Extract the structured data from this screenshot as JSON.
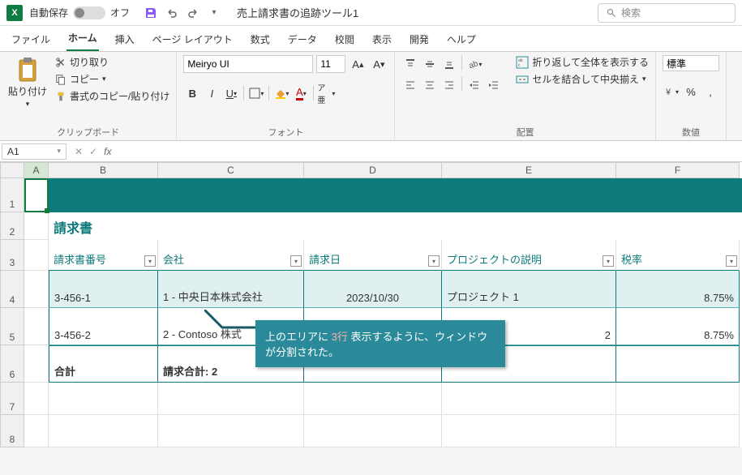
{
  "title_bar": {
    "excel_icon_text": "X",
    "autosave_label": "自動保存",
    "autosave_state": "オフ",
    "doc_title": "売上請求書の追跡ツール1",
    "search_placeholder": "検索"
  },
  "tabs": {
    "file": "ファイル",
    "home": "ホーム",
    "insert": "挿入",
    "page_layout": "ページ レイアウト",
    "formulas": "数式",
    "data": "データ",
    "review": "校閲",
    "view": "表示",
    "developer": "開発",
    "help": "ヘルプ"
  },
  "ribbon": {
    "clipboard": {
      "paste": "貼り付け",
      "cut": "切り取り",
      "copy": "コピー",
      "format_painter": "書式のコピー/貼り付け",
      "group_label": "クリップボード"
    },
    "font": {
      "name": "Meiryo UI",
      "size": "11",
      "group_label": "フォント"
    },
    "alignment": {
      "wrap": "折り返して全体を表示する",
      "merge": "セルを結合して中央揃え",
      "group_label": "配置"
    },
    "number": {
      "format": "標準",
      "group_label": "数値"
    }
  },
  "formula_bar": {
    "name_box": "A1"
  },
  "columns": [
    "A",
    "B",
    "C",
    "D",
    "E",
    "F"
  ],
  "rows": [
    "1",
    "2",
    "3",
    "4",
    "5",
    "6",
    "7",
    "8"
  ],
  "sheet": {
    "title": "請求書",
    "headers": {
      "invoice_no": "請求書番号",
      "company": "会社",
      "invoice_date": "請求日",
      "project_desc": "プロジェクトの説明",
      "tax_rate": "税率"
    },
    "data": [
      {
        "invoice_no": "3-456-1",
        "company": "1 - 中央日本株式会社",
        "invoice_date": "2023/10/30",
        "project_desc": "プロジェクト 1",
        "tax_rate": "8.75%"
      },
      {
        "invoice_no": "3-456-2",
        "company": "2 - Contoso 株式",
        "invoice_date": "",
        "project_desc": "",
        "tax_rate": "8.75%",
        "project_suffix": "2"
      }
    ],
    "totals": {
      "label": "合計",
      "invoice_total": "請求合計: 2"
    }
  },
  "callout": {
    "pre": "上のエリアに ",
    "highlight": "3行",
    "post": " 表示するように、ウィンドウが分割された。"
  }
}
